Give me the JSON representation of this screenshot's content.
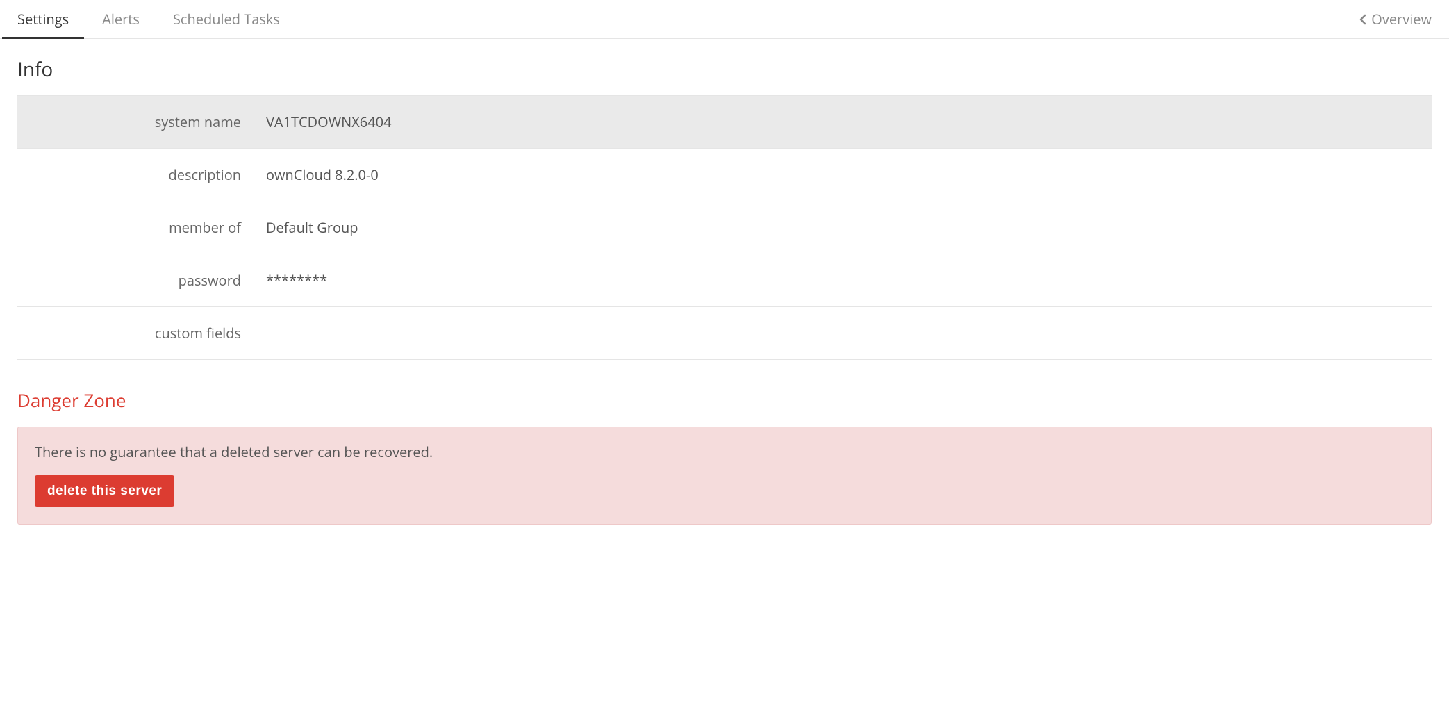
{
  "tabs": {
    "settings": "Settings",
    "alerts": "Alerts",
    "scheduled_tasks": "Scheduled Tasks",
    "overview": "Overview"
  },
  "info": {
    "heading": "Info",
    "rows": {
      "system_name": {
        "label": "system name",
        "value": "VA1TCDOWNX6404"
      },
      "description": {
        "label": "description",
        "value": "ownCloud 8.2.0-0"
      },
      "member_of": {
        "label": "member of",
        "value": "Default Group"
      },
      "password": {
        "label": "password",
        "value": "********"
      },
      "custom_fields": {
        "label": "custom fields",
        "value": ""
      }
    }
  },
  "danger": {
    "heading": "Danger Zone",
    "warning": "There is no guarantee that a deleted server can be recovered.",
    "delete_label": "delete this server"
  }
}
